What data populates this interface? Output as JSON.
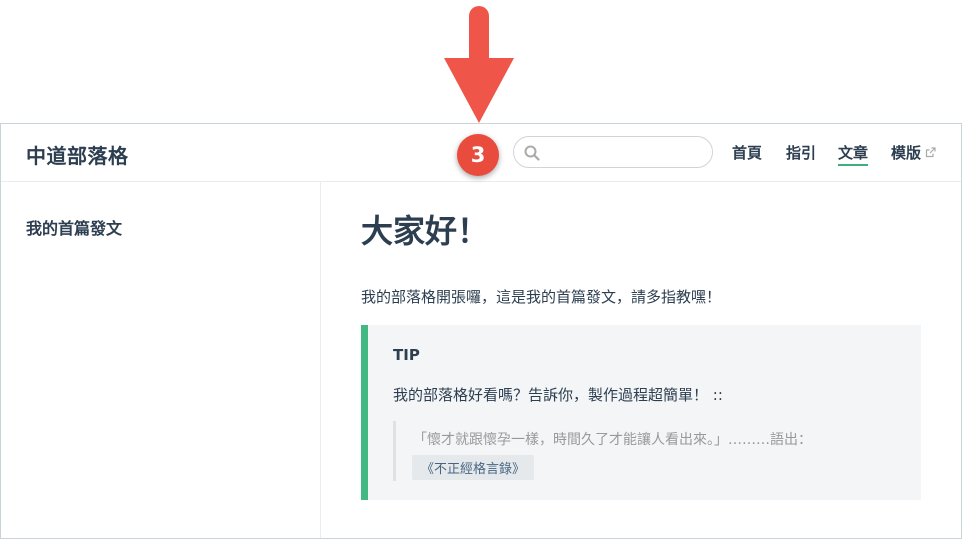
{
  "annotation": {
    "step_number": "3",
    "accent_color": "#e94b3c"
  },
  "navbar": {
    "site_title": "中道部落格",
    "search": {
      "placeholder": "",
      "value": "",
      "icon": "search-icon"
    },
    "links": [
      {
        "label": "首頁",
        "active": false
      },
      {
        "label": "指引",
        "active": false
      },
      {
        "label": "文章",
        "active": true
      },
      {
        "label": "模版",
        "active": false,
        "external": true,
        "icon": "external-link-icon"
      }
    ],
    "active_color": "#3eaf7c"
  },
  "sidebar": {
    "items": [
      {
        "label": "我的首篇發文"
      }
    ]
  },
  "article": {
    "title": "大家好！",
    "intro": "我的部落格開張囉，這是我的首篇發文，請多指教嘿！",
    "tip": {
      "title": "TIP",
      "text": "我的部落格好看嗎？告訴你，製作過程超簡單！ ::",
      "quote": {
        "text": "「懷才就跟懷孕一樣，時間久了才能讓人看出來。」………語出：",
        "source": "《不正經格言錄》"
      },
      "border_color": "#42b983"
    }
  }
}
